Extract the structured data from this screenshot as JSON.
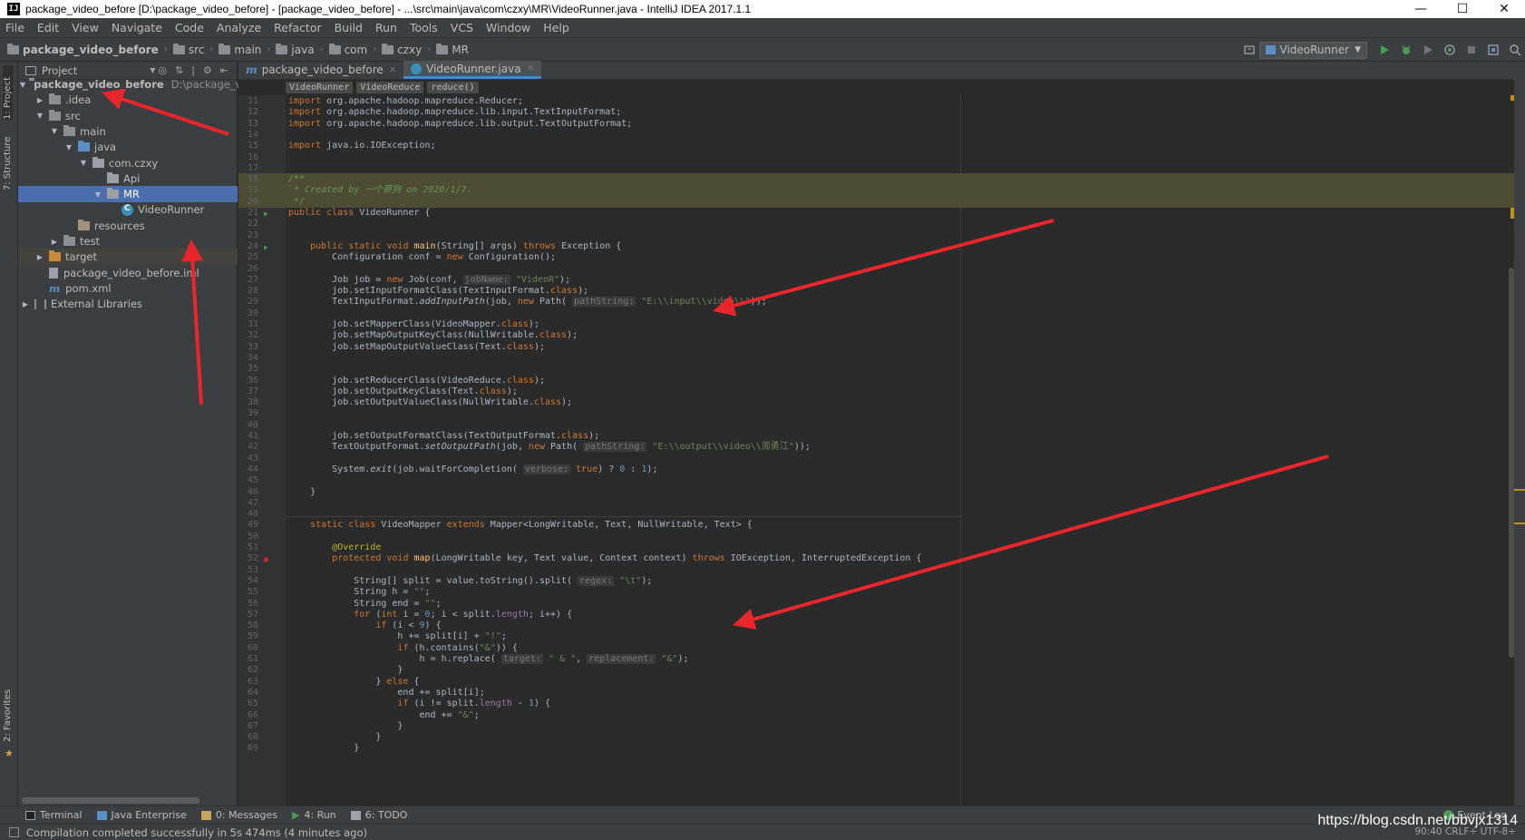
{
  "window": {
    "title": "package_video_before [D:\\package_video_before] - [package_video_before] - ...\\src\\main\\java\\com\\czxy\\MR\\VideoRunner.java - IntelliJ IDEA 2017.1.1",
    "icon_text": "IJ"
  },
  "menu": [
    "File",
    "Edit",
    "View",
    "Navigate",
    "Code",
    "Analyze",
    "Refactor",
    "Build",
    "Run",
    "Tools",
    "VCS",
    "Window",
    "Help"
  ],
  "navbar": {
    "crumbs": [
      "package_video_before",
      "src",
      "main",
      "java",
      "com",
      "czxy",
      "MR"
    ],
    "run_config": "VideoRunner"
  },
  "left_strip": {
    "project_tab": "1: Project",
    "structure_tab": "7: Structure",
    "favorites_tab": "2: Favorites"
  },
  "project_panel": {
    "header": "Project",
    "tree": [
      {
        "label": "package_video_before",
        "hint": "D:\\package_vid",
        "depth": 0,
        "expanded": true,
        "icon": "project-folder",
        "bold": true
      },
      {
        "label": ".idea",
        "depth": 1,
        "expanded": false,
        "icon": "folder"
      },
      {
        "label": "src",
        "depth": 1,
        "expanded": true,
        "icon": "folder"
      },
      {
        "label": "main",
        "depth": 2,
        "expanded": true,
        "icon": "folder"
      },
      {
        "label": "java",
        "depth": 3,
        "expanded": true,
        "icon": "source-folder"
      },
      {
        "label": "com.czxy",
        "depth": 4,
        "expanded": true,
        "icon": "package"
      },
      {
        "label": "Api",
        "depth": 5,
        "icon": "package"
      },
      {
        "label": "MR",
        "depth": 5,
        "expanded": true,
        "icon": "package",
        "selected": true
      },
      {
        "label": "VideoRunner",
        "depth": 6,
        "icon": "class"
      },
      {
        "label": "resources",
        "depth": 3,
        "icon": "resources-folder"
      },
      {
        "label": "test",
        "depth": 2,
        "expanded": false,
        "icon": "folder"
      },
      {
        "label": "target",
        "depth": 1,
        "expanded": false,
        "icon": "excluded-folder",
        "dim": true
      },
      {
        "label": "package_video_before.iml",
        "depth": 1,
        "icon": "file"
      },
      {
        "label": "pom.xml",
        "depth": 1,
        "icon": "maven"
      },
      {
        "label": "External Libraries",
        "depth": 0,
        "expanded": false,
        "icon": "library"
      }
    ]
  },
  "editor": {
    "tabs": [
      {
        "label": "package_video_before",
        "active": false
      },
      {
        "label": "VideoRunner.java",
        "active": true
      }
    ],
    "breadcrumbs": [
      "VideoRunner",
      "VideoReduce",
      "reduce()"
    ],
    "lines": [
      {
        "n": "11",
        "html": "<span class=\"kw\">import</span> org.apache.hadoop.mapreduce.Reducer;"
      },
      {
        "n": "12",
        "html": "<span class=\"kw\">import</span> org.apache.hadoop.mapreduce.lib.input.TextInputFormat;"
      },
      {
        "n": "13",
        "html": "<span class=\"kw\">import</span> org.apache.hadoop.mapreduce.lib.output.TextOutputFormat;"
      },
      {
        "n": "14",
        "html": ""
      },
      {
        "n": "15",
        "html": "<span class=\"kw\">import</span> java.io.IOException;"
      },
      {
        "n": "16",
        "html": ""
      },
      {
        "n": "17",
        "html": ""
      },
      {
        "n": "18",
        "html": "<span class=\"doc\">/**</span>",
        "hl": true
      },
      {
        "n": "19",
        "html": "<span class=\"doc\"> * Created by 一个蔡狗 on 2020/1/7.</span>",
        "hl": true
      },
      {
        "n": "20",
        "html": "<span class=\"doc\"> */</span>",
        "hl": true
      },
      {
        "n": "21",
        "html": "<span class=\"kw\">public class</span> VideoRunner {",
        "run": true
      },
      {
        "n": "22",
        "html": ""
      },
      {
        "n": "23",
        "html": ""
      },
      {
        "n": "24",
        "html": "    <span class=\"kw\">public static void</span> <span class=\"fn\">main</span>(String[] args) <span class=\"kw\">throws</span> Exception {",
        "run": true
      },
      {
        "n": "25",
        "html": "        Configuration conf = <span class=\"kw\">new</span> Configuration();"
      },
      {
        "n": "26",
        "html": ""
      },
      {
        "n": "27",
        "html": "        Job job = <span class=\"kw\">new</span> Job(conf, <span class=\"hint\">jobName:</span> <span class=\"str\">\"VideoR\"</span>);"
      },
      {
        "n": "28",
        "html": "        job.setInputFormatClass(TextInputFormat.<span class=\"kw\">class</span>);"
      },
      {
        "n": "29",
        "html": "        TextInputFormat.<span class=\"ital\">addInputPath</span>(job, <span class=\"kw\">new</span> Path( <span class=\"hint\">pathString:</span> <span class=\"str\">\"E:\\\\input\\\\video\\\\\"</span>));"
      },
      {
        "n": "30",
        "html": ""
      },
      {
        "n": "31",
        "html": "        job.setMapperClass(VideoMapper.<span class=\"kw\">class</span>);"
      },
      {
        "n": "32",
        "html": "        job.setMapOutputKeyClass(NullWritable.<span class=\"kw\">class</span>);"
      },
      {
        "n": "33",
        "html": "        job.setMapOutputValueClass(Text.<span class=\"kw\">class</span>);"
      },
      {
        "n": "34",
        "html": ""
      },
      {
        "n": "35",
        "html": ""
      },
      {
        "n": "36",
        "html": "        job.setReducerClass(VideoReduce.<span class=\"kw\">class</span>);"
      },
      {
        "n": "37",
        "html": "        job.setOutputKeyClass(Text.<span class=\"kw\">class</span>);"
      },
      {
        "n": "38",
        "html": "        job.setOutputValueClass(NullWritable.<span class=\"kw\">class</span>);"
      },
      {
        "n": "39",
        "html": ""
      },
      {
        "n": "40",
        "html": ""
      },
      {
        "n": "41",
        "html": "        job.setOutputFormatClass(TextOutputFormat.<span class=\"kw\">class</span>);"
      },
      {
        "n": "42",
        "html": "        TextOutputFormat.<span class=\"ital\">setOutputPath</span>(job, <span class=\"kw\">new</span> Path( <span class=\"hint\">pathString:</span> <span class=\"str\">\"E:\\\\output\\\\video\\\\周勇江\"</span>));"
      },
      {
        "n": "43",
        "html": ""
      },
      {
        "n": "44",
        "html": "        System.<span class=\"ital\">exit</span>(job.waitForCompletion( <span class=\"hint\">verbose:</span> <span class=\"kw\">true</span>) ? <span class=\"num\">0</span> : <span class=\"num\">1</span>);"
      },
      {
        "n": "45",
        "html": ""
      },
      {
        "n": "46",
        "html": "    }"
      },
      {
        "n": "47",
        "html": ""
      },
      {
        "n": "48",
        "html": ""
      },
      {
        "n": "49",
        "html": "    <span class=\"kw\">static class</span> VideoMapper <span class=\"kw\">extends</span> Mapper&lt;LongWritable, Text, NullWritable, Text&gt; {"
      },
      {
        "n": "50",
        "html": ""
      },
      {
        "n": "51",
        "html": "        <span class=\"ann\">@Override</span>"
      },
      {
        "n": "52",
        "html": "        <span class=\"kw\">protected void</span> <span class=\"fn\">map</span>(LongWritable key, Text value, Context context) <span class=\"kw\">throws</span> IOException, InterruptedException {",
        "override": true
      },
      {
        "n": "53",
        "html": ""
      },
      {
        "n": "54",
        "html": "            String[] split = value.toString().split( <span class=\"hint\">regex:</span> <span class=\"str\">\"\\t\"</span>);"
      },
      {
        "n": "55",
        "html": "            String h = <span class=\"str\">\"\"</span>;"
      },
      {
        "n": "56",
        "html": "            String end = <span class=\"str\">\"\"</span>;"
      },
      {
        "n": "57",
        "html": "            <span class=\"kw\">for</span> (<span class=\"kw\">int</span> i = <span class=\"num\">0</span>; i &lt; split.<span class=\"purple\">length</span>; i++) {"
      },
      {
        "n": "58",
        "html": "                <span class=\"kw\">if</span> (i &lt; <span class=\"num\">9</span>) {"
      },
      {
        "n": "59",
        "html": "                    h += split[i] + <span class=\"str\">\"!\"</span>;"
      },
      {
        "n": "60",
        "html": "                    <span class=\"kw\">if</span> (h.contains(<span class=\"str\">\"&amp;\"</span>)) {"
      },
      {
        "n": "61",
        "html": "                        h = h.replace( <span class=\"hint\">target:</span> <span class=\"str\">\" &amp; \"</span>, <span class=\"hint\">replacement:</span> <span class=\"str\">\"&amp;\"</span>);"
      },
      {
        "n": "62",
        "html": "                    }"
      },
      {
        "n": "63",
        "html": "                } <span class=\"kw\">else</span> {"
      },
      {
        "n": "64",
        "html": "                    end += split[i];"
      },
      {
        "n": "65",
        "html": "                    <span class=\"kw\">if</span> (i != split.<span class=\"purple\">length</span> - <span class=\"num\">1</span>) {"
      },
      {
        "n": "66",
        "html": "                        end += <span class=\"str\">\"&amp;\"</span>;"
      },
      {
        "n": "67",
        "html": "                    }"
      },
      {
        "n": "68",
        "html": "                }"
      },
      {
        "n": "69",
        "html": "            }"
      }
    ]
  },
  "bottom_tools": [
    "Terminal",
    "Java Enterprise",
    "0: Messages",
    "4: Run",
    "6: TODO"
  ],
  "event_log": "Event Log",
  "status": {
    "message": "Compilation completed successfully in 5s 474ms (4 minutes ago)",
    "right": "90:40  CRLF÷  UTF-8÷"
  },
  "watermark": "https://blog.csdn.net/bbvjx1314",
  "colors": {
    "accent": "#4b6eaf",
    "arrow": "#e8262c",
    "run_green": "#499c54"
  }
}
